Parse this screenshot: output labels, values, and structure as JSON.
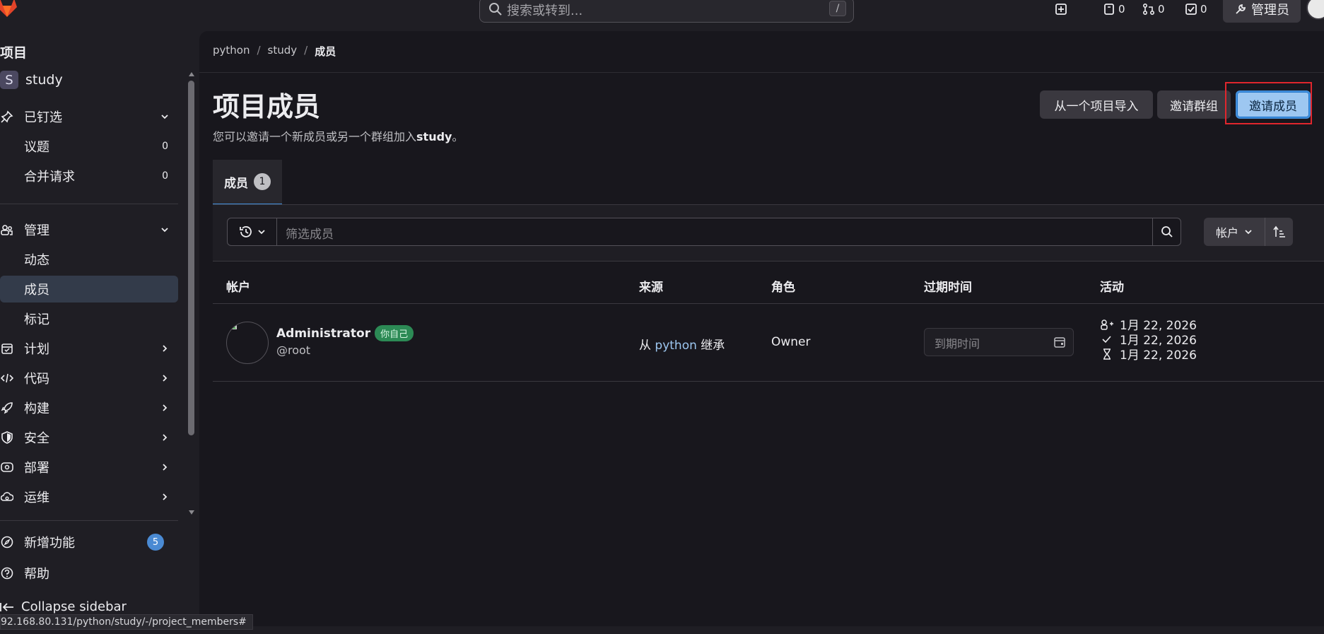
{
  "topbar": {
    "search_placeholder": "搜索或转到...",
    "search_kbd": "/",
    "issues_count": "0",
    "mr_count": "0",
    "todos_count": "0",
    "admin_label": "管理员"
  },
  "sidebar": {
    "section_title": "项目",
    "project_initial": "S",
    "project_name": "study",
    "pinned": "已钉选",
    "pinned_items": [
      {
        "label": "议题",
        "count": "0"
      },
      {
        "label": "合并请求",
        "count": "0"
      }
    ],
    "manage": "管理",
    "manage_items": [
      "动态",
      "成员",
      "标记"
    ],
    "groups": [
      "计划",
      "代码",
      "构建",
      "安全",
      "部署",
      "运维"
    ],
    "whats_new": "新增功能",
    "whats_new_count": "5",
    "help": "帮助",
    "collapse": "Collapse sidebar"
  },
  "breadcrumb": [
    "python",
    "study",
    "成员"
  ],
  "page": {
    "title": "项目成员",
    "desc_prefix": "您可以邀请一个新成员或另一个群组加入",
    "desc_project": "study",
    "desc_suffix": "。",
    "btn_import": "从一个项目导入",
    "btn_invite_group": "邀请群组",
    "btn_invite_member": "邀请成员"
  },
  "tab": {
    "label": "成员",
    "count": "1"
  },
  "filter": {
    "placeholder": "筛选成员",
    "sort_label": "帐户"
  },
  "table": {
    "headers": [
      "帐户",
      "来源",
      "角色",
      "过期时间",
      "活动"
    ],
    "row": {
      "name": "Administrator",
      "badge": "你自己",
      "handle": "@root",
      "source_prefix": "从",
      "source_link": "python",
      "source_suffix": "继承",
      "role": "Owner",
      "expiry_placeholder": "到期时间",
      "activity": [
        "1月 22, 2026",
        "1月 22, 2026",
        "1月 22, 2026"
      ]
    }
  },
  "status_url": "92.168.80.131/python/study/-/project_members#",
  "colors": {
    "accent": "#428fdc",
    "primary_button": "#9dc7f1",
    "highlight": "#e0262d",
    "success_badge": "#2c8a55"
  }
}
